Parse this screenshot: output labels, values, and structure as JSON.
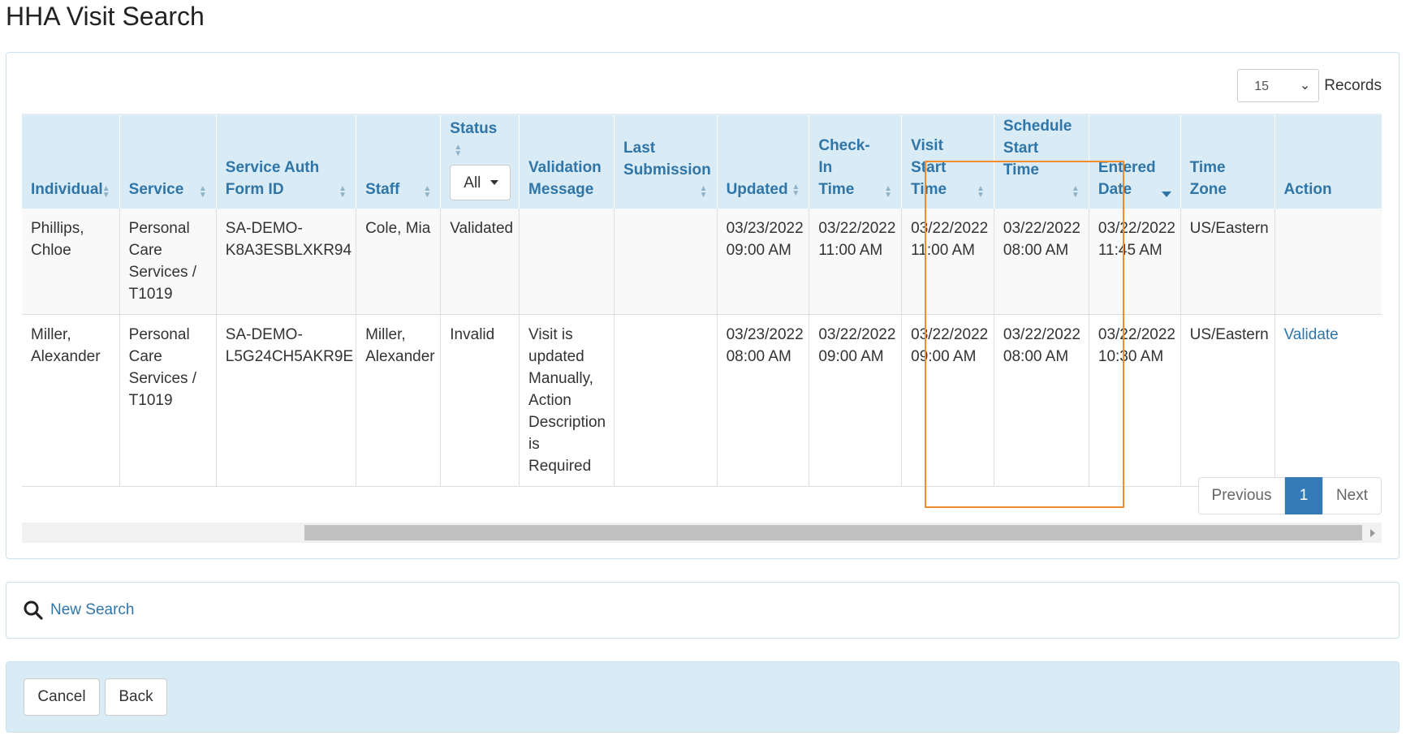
{
  "page": {
    "title": "HHA Visit Search"
  },
  "records": {
    "value": "15",
    "label": "Records"
  },
  "table": {
    "headers": {
      "individual": "Individual",
      "service": "Service",
      "service_auth_line1": "Service Auth",
      "service_auth_line2": "Form ID",
      "staff": "Staff",
      "status": "Status",
      "status_filter": "All",
      "validation_line1": "Validation",
      "validation_line2": "Message",
      "last_sub_line1": "Last",
      "last_sub_line2": "Submission",
      "updated": "Updated",
      "checkin_line1": "Check-In",
      "checkin_line2": "Time",
      "visit_start_line1": "Visit Start",
      "visit_start_line2": "Time",
      "schedule_start_line1": "Schedule",
      "schedule_start_line2": "Start Time",
      "entered_line1": "Entered",
      "entered_line2": "Date",
      "time_zone": "Time Zone",
      "action": "Action"
    },
    "rows": [
      {
        "individual": [
          "Phillips,",
          "Chloe"
        ],
        "service": [
          "Personal",
          "Care",
          "Services /",
          "T1019"
        ],
        "service_auth": [
          "SA-DEMO-",
          "K8A3ESBLXKR94"
        ],
        "staff": [
          "Cole, Mia"
        ],
        "status": "Validated",
        "validation_message": [],
        "last_submission": "",
        "updated": [
          "03/23/2022",
          "09:00 AM"
        ],
        "checkin": [
          "03/22/2022",
          "11:00 AM"
        ],
        "visit_start": [
          "03/22/2022",
          "11:00 AM"
        ],
        "schedule_start": [
          "03/22/2022",
          "08:00 AM"
        ],
        "entered": [
          "03/22/2022",
          "11:45 AM"
        ],
        "time_zone": "US/Eastern",
        "action": ""
      },
      {
        "individual": [
          "Miller,",
          "Alexander"
        ],
        "service": [
          "Personal",
          "Care",
          "Services /",
          "T1019"
        ],
        "service_auth": [
          "SA-DEMO-",
          "L5G24CH5AKR9E"
        ],
        "staff": [
          "Miller,",
          "Alexander"
        ],
        "status": "Invalid",
        "validation_message": [
          "Visit is",
          "updated",
          "Manually,",
          "Action",
          "Description",
          "is Required"
        ],
        "last_submission": "",
        "updated": [
          "03/23/2022",
          "08:00 AM"
        ],
        "checkin": [
          "03/22/2022",
          "09:00 AM"
        ],
        "visit_start": [
          "03/22/2022",
          "09:00 AM"
        ],
        "schedule_start": [
          "03/22/2022",
          "08:00 AM"
        ],
        "entered": [
          "03/22/2022",
          "10:30 AM"
        ],
        "time_zone": "US/Eastern",
        "action": "Validate"
      }
    ]
  },
  "pagination": {
    "previous": "Previous",
    "current": "1",
    "next": "Next"
  },
  "search": {
    "new_search": "New Search"
  },
  "actions": {
    "cancel": "Cancel",
    "back": "Back"
  },
  "colors": {
    "accent": "#2f75a8",
    "header_bg": "#d9ebf4",
    "highlight": "#f28a2e",
    "page_active": "#337ab7"
  }
}
